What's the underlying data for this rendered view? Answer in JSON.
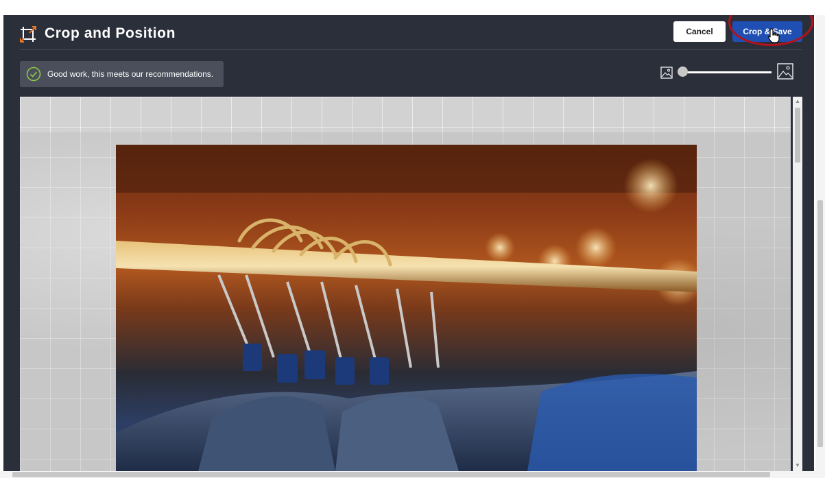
{
  "header": {
    "title": "Crop and Position",
    "cancel_label": "Cancel",
    "save_label": "Crop & Save"
  },
  "banner": {
    "message": "Good work, this meets our recommendations."
  },
  "zoom": {
    "value_fraction": 0.0
  },
  "icons": {
    "title": "crop-icon",
    "banner": "check-circle-icon",
    "zoom_out": "image-small-icon",
    "zoom_in": "image-large-icon",
    "cursor": "hand-pointer-icon"
  },
  "colors": {
    "dialog_bg": "#2b2f3a",
    "save_button": "#1f4fb3",
    "accent_orange": "#e8782a",
    "check_green": "#8fcf3f",
    "highlight_ring": "#b5121b"
  }
}
